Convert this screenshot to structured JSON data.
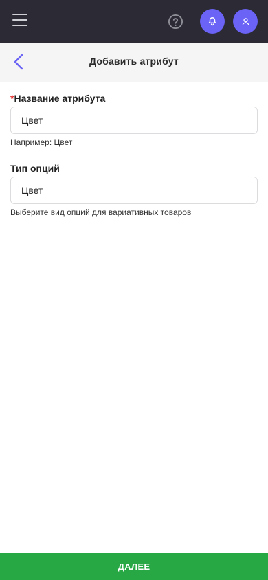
{
  "topbar": {
    "menu_icon": "hamburger-icon",
    "help_icon": "question-circle-icon",
    "notifications_icon": "bell-icon",
    "profile_icon": "user-icon",
    "background": "#2b2a35",
    "accent": "#6a63f5"
  },
  "header": {
    "back_icon": "chevron-left-icon",
    "title": "Добавить атрибут"
  },
  "form": {
    "attribute_name": {
      "required_mark": "*",
      "label": "Название атрибута",
      "value": "Цвет",
      "hint": "Например: Цвет"
    },
    "option_type": {
      "label": "Тип опций",
      "value": "Цвет",
      "hint": "Выберите вид опций для вариативных товаров"
    }
  },
  "footer": {
    "next_label": "ДАЛЕЕ",
    "color": "#27a844"
  }
}
